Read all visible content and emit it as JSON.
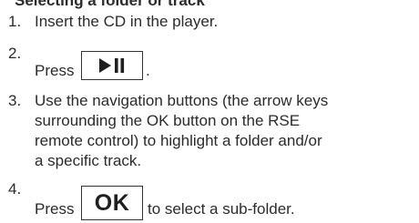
{
  "heading": "Selecting a folder or track",
  "steps": [
    {
      "number": "1.",
      "lines": [
        "Insert the CD in the player."
      ]
    },
    {
      "number": "2.",
      "before": "Press",
      "key": "play-pause-icon",
      "after": "."
    },
    {
      "number": "3.",
      "lines": [
        "Use the navigation buttons (the arrow keys",
        "surrounding the OK button on the RSE",
        "remote control) to highlight a folder and/or",
        "a specific track."
      ]
    },
    {
      "number": "4.",
      "before": "Press",
      "key_label": "OK",
      "after": "to select a sub-folder."
    }
  ]
}
